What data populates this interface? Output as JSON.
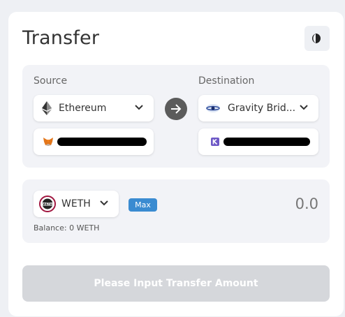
{
  "header": {
    "title": "Transfer",
    "theme_toggle_icon": "moon-icon"
  },
  "source": {
    "label": "Source",
    "network": "Ethereum",
    "network_icon": "ethereum-icon",
    "wallet_icon": "metamask-icon",
    "address_redacted": true
  },
  "swap_icon": "arrow-right-icon",
  "destination": {
    "label": "Destination",
    "network": "Gravity Brid...",
    "network_icon": "gravity-bridge-icon",
    "wallet_icon": "keplr-icon",
    "address_redacted": true
  },
  "asset": {
    "symbol": "WETH",
    "icon": "weth-icon",
    "max_label": "Max",
    "amount_placeholder": "0.0",
    "balance_text": "Balance: 0 WETH"
  },
  "submit": {
    "label": "Please Input Transfer Amount",
    "enabled": false
  },
  "colors": {
    "background": "#eef0f4",
    "card": "#ffffff",
    "panel": "#f2f3f7",
    "accent": "#3a8bd1",
    "disabled_button": "#d5d7db",
    "arrow_button": "#5b5b5b"
  }
}
